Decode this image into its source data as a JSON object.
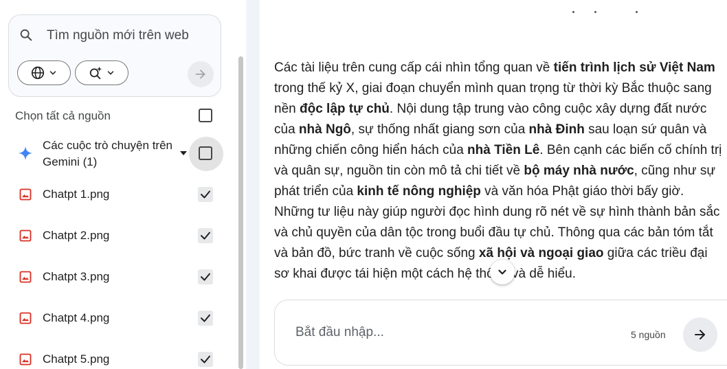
{
  "source_search": {
    "placeholder": "Tìm nguồn mới trên web"
  },
  "select_all": {
    "label": "Chọn tất cả nguồn",
    "checked": false
  },
  "gemini_group": {
    "label": "Các cuộc trò chuyện trên Gemini (1)",
    "icon": "gemini-spark-icon",
    "checked": false
  },
  "sources": [
    {
      "label": "Chatpt 1.png",
      "icon": "image-file-icon",
      "checked": true
    },
    {
      "label": "Chatpt 2.png",
      "icon": "image-file-icon",
      "checked": true
    },
    {
      "label": "Chatpt 3.png",
      "icon": "image-file-icon",
      "checked": true
    },
    {
      "label": "Chatpt 4.png",
      "icon": "image-file-icon",
      "checked": true
    },
    {
      "label": "Chatpt 5.png",
      "icon": "image-file-icon",
      "checked": true
    }
  ],
  "summary": {
    "segments": [
      {
        "text": "Các tài liệu trên cung cấp cái nhìn tổng quan về ",
        "bold": false
      },
      {
        "text": "tiến trình lịch sử Việt Nam",
        "bold": true
      },
      {
        "text": " trong thế kỷ X, giai đoạn chuyển mình quan trọng từ thời kỳ Bắc thuộc sang nền ",
        "bold": false
      },
      {
        "text": "độc lập tự chủ",
        "bold": true
      },
      {
        "text": ". Nội dung tập trung vào công cuộc xây dựng đất nước của ",
        "bold": false
      },
      {
        "text": "nhà Ngô",
        "bold": true
      },
      {
        "text": ", sự thống nhất giang sơn của ",
        "bold": false
      },
      {
        "text": "nhà Đinh",
        "bold": true
      },
      {
        "text": " sau loạn sứ quân và những chiến công hiển hách của ",
        "bold": false
      },
      {
        "text": "nhà Tiền Lê",
        "bold": true
      },
      {
        "text": ". Bên cạnh các biến cố chính trị và quân sự, nguồn tin còn mô tả chi tiết về ",
        "bold": false
      },
      {
        "text": "bộ máy nhà nước",
        "bold": true
      },
      {
        "text": ", cũng như sự phát triển của ",
        "bold": false
      },
      {
        "text": "kinh tế nông nghiệp",
        "bold": true
      },
      {
        "text": " và văn hóa Phật giáo thời bấy giờ. Những tư liệu này giúp người đọc hình dung rõ nét về sự hình thành bản sắc và chủ quyền của dân tộc trong buổi đầu tự chủ. Thông qua các bản tóm tắt và bản đồ, bức tranh về cuộc sống ",
        "bold": false
      },
      {
        "text": "xã hội và ngoại giao",
        "bold": true
      },
      {
        "text": " giữa các triều đại sơ khai được tái hiện một cách hệ thống và dễ hiểu.",
        "bold": false
      }
    ]
  },
  "chat": {
    "placeholder": "Bắt đầu nhập...",
    "source_count": "5 nguồn"
  },
  "colors": {
    "accent_red": "#d93025",
    "gemini_blue": "#4285f4",
    "panel_gap": "#f0f4f9"
  }
}
